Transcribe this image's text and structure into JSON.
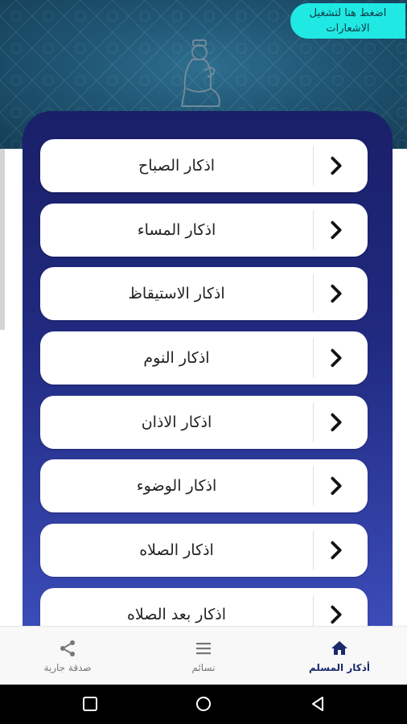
{
  "header": {
    "notification_button_label": "اضغط هنا لتشغيل الاشعارات"
  },
  "azkar_list": [
    {
      "label": "اذكار الصباح"
    },
    {
      "label": "اذكار المساء"
    },
    {
      "label": "اذكار الاستيقاظ"
    },
    {
      "label": "اذكار النوم"
    },
    {
      "label": "اذكار الاذان"
    },
    {
      "label": "اذكار الوضوء"
    },
    {
      "label": "اذكار الصلاه"
    },
    {
      "label": "اذكار بعد الصلاه"
    }
  ],
  "bottom_nav": {
    "items": [
      {
        "label": "صدقة جارية",
        "icon": "share-icon"
      },
      {
        "label": "نسائم",
        "icon": "menu-icon"
      },
      {
        "label": "أذكار المسلم",
        "icon": "home-icon",
        "active": true
      }
    ]
  },
  "colors": {
    "header_teal": "#1f5674",
    "notification_button": "#20e8e2",
    "panel_top": "#1a1f68",
    "panel_bottom": "#3b4cb8",
    "active_nav": "#1a2a6c"
  }
}
